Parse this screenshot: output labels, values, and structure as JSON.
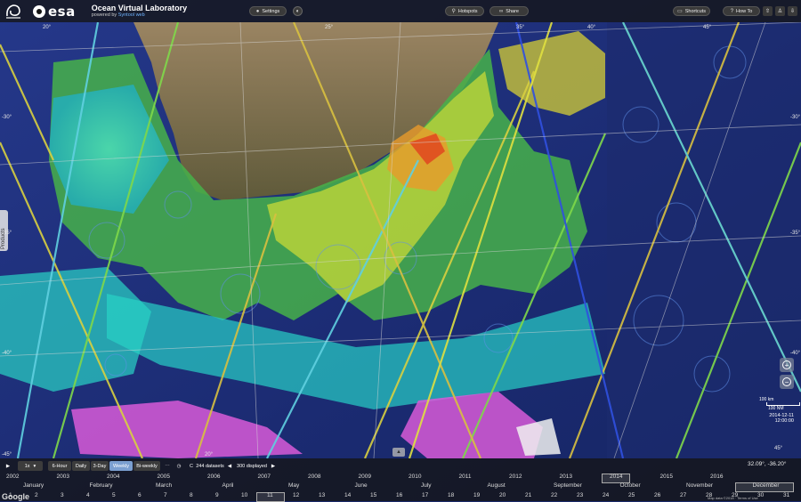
{
  "app": {
    "brand": "esa",
    "title": "Ocean Virtual Laboratory",
    "powered_by": "powered by",
    "powered_link": "Syntool web"
  },
  "toolbar": {
    "settings": "Settings",
    "hotspots": "Hotspots",
    "share": "Share",
    "shortcuts": "Shortcuts",
    "howto": "How To"
  },
  "side": {
    "products": "Products"
  },
  "map": {
    "lat_labels": [
      "-30°",
      "-35°",
      "-40°",
      "-45°",
      "-30°",
      "-35°",
      "-40°"
    ],
    "lon_labels": [
      "20°",
      "25°",
      "35°",
      "40°",
      "45°",
      "20°",
      "45°"
    ],
    "scale_km": "100 km",
    "scale_nm": "100 NM",
    "date": "2014-12-11",
    "time": "12:00:00",
    "coords": "32.09°, -36.20°",
    "attribution": "Map data ©2018 · Terms of Use"
  },
  "timeline": {
    "step": "1x",
    "periods": [
      "6-Hour",
      "Daily",
      "3-Day",
      "Weekly",
      "Bi-weekly"
    ],
    "active_period": "Weekly",
    "datasets": "244 datasets",
    "displayed": "300 displayed",
    "years": [
      "2002",
      "2003",
      "2004",
      "2005",
      "2006",
      "2007",
      "2008",
      "2009",
      "2010",
      "2011",
      "2012",
      "2013",
      "2014",
      "2015",
      "2016"
    ],
    "selected_year": "2014",
    "months": [
      "January",
      "February",
      "March",
      "April",
      "May",
      "June",
      "July",
      "August",
      "September",
      "October",
      "November",
      "December"
    ],
    "selected_month": "December",
    "days": [
      "1",
      "2",
      "3",
      "4",
      "5",
      "6",
      "7",
      "8",
      "9",
      "10",
      "11",
      "12",
      "13",
      "14",
      "15",
      "16",
      "17",
      "18",
      "19",
      "20",
      "21",
      "22",
      "23",
      "24",
      "25",
      "26",
      "27",
      "28",
      "29",
      "30",
      "31"
    ],
    "selected_day": "11"
  },
  "colors": {
    "ocean": "#1e2f7a",
    "land": "#7a6a4a",
    "bar": "#141414",
    "active": "#7b9fd0"
  },
  "footer": {
    "google": "Google"
  }
}
